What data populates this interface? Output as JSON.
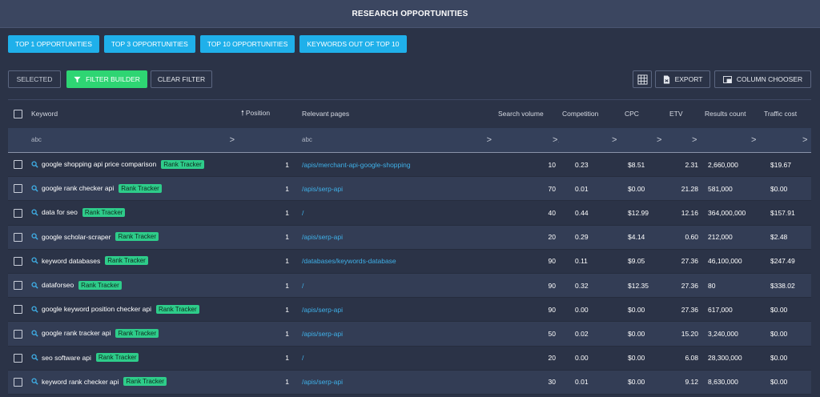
{
  "header": {
    "title": "RESEARCH OPPORTUNITIES"
  },
  "presets": [
    {
      "label": "TOP 1 OPPORTUNITIES"
    },
    {
      "label": "TOP 3 OPPORTUNITIES"
    },
    {
      "label": "TOP 10 OPPORTUNITIES"
    },
    {
      "label": "KEYWORDS OUT OF TOP 10"
    }
  ],
  "toolbar": {
    "selected_label": "SELECTED",
    "filter_builder_label": "FILTER BUILDER",
    "clear_filter_label": "CLEAR FILTER",
    "export_label": "EXPORT",
    "column_chooser_label": "COLUMN CHOOSER"
  },
  "colors": {
    "accent": "#1fb0ea",
    "filter_green": "#2ed573",
    "badge_green": "#2ecc8a",
    "link": "#3fb0e8"
  },
  "table": {
    "columns": {
      "keyword": "Keyword",
      "position": "Position",
      "pages": "Relevant pages",
      "volume": "Search volume",
      "competition": "Competition",
      "cpc": "CPC",
      "etv": "ETV",
      "results": "Results count",
      "traffic_cost": "Traffic cost"
    },
    "sort": {
      "column": "position",
      "direction": "ascending"
    },
    "filter_placeholder": "abc",
    "filter_operator": ">",
    "badge_label": "Rank Tracker",
    "rows": [
      {
        "keyword": "google shopping api price comparison",
        "position": "1",
        "page": "/apis/merchant-api-google-shopping",
        "volume": "10",
        "competition": "0.23",
        "cpc": "$8.51",
        "etv": "2.31",
        "results": "2,660,000",
        "cost": "$19.67"
      },
      {
        "keyword": "google rank checker api",
        "position": "1",
        "page": "/apis/serp-api",
        "volume": "70",
        "competition": "0.01",
        "cpc": "$0.00",
        "etv": "21.28",
        "results": "581,000",
        "cost": "$0.00"
      },
      {
        "keyword": "data for seo",
        "position": "1",
        "page": "/",
        "volume": "40",
        "competition": "0.44",
        "cpc": "$12.99",
        "etv": "12.16",
        "results": "364,000,000",
        "cost": "$157.91"
      },
      {
        "keyword": "google scholar-scraper",
        "position": "1",
        "page": "/apis/serp-api",
        "volume": "20",
        "competition": "0.29",
        "cpc": "$4.14",
        "etv": "0.60",
        "results": "212,000",
        "cost": "$2.48"
      },
      {
        "keyword": "keyword databases",
        "position": "1",
        "page": "/databases/keywords-database",
        "volume": "90",
        "competition": "0.11",
        "cpc": "$9.05",
        "etv": "27.36",
        "results": "46,100,000",
        "cost": "$247.49"
      },
      {
        "keyword": "dataforseo",
        "position": "1",
        "page": "/",
        "volume": "90",
        "competition": "0.32",
        "cpc": "$12.35",
        "etv": "27.36",
        "results": "80",
        "cost": "$338.02"
      },
      {
        "keyword": "google keyword position checker api",
        "position": "1",
        "page": "/apis/serp-api",
        "volume": "90",
        "competition": "0.00",
        "cpc": "$0.00",
        "etv": "27.36",
        "results": "617,000",
        "cost": "$0.00"
      },
      {
        "keyword": "google rank tracker api",
        "position": "1",
        "page": "/apis/serp-api",
        "volume": "50",
        "competition": "0.02",
        "cpc": "$0.00",
        "etv": "15.20",
        "results": "3,240,000",
        "cost": "$0.00"
      },
      {
        "keyword": "seo software api",
        "position": "1",
        "page": "/",
        "volume": "20",
        "competition": "0.00",
        "cpc": "$0.00",
        "etv": "6.08",
        "results": "28,300,000",
        "cost": "$0.00"
      },
      {
        "keyword": "keyword rank checker api",
        "position": "1",
        "page": "/apis/serp-api",
        "volume": "30",
        "competition": "0.01",
        "cpc": "$0.00",
        "etv": "9.12",
        "results": "8,630,000",
        "cost": "$0.00"
      }
    ]
  }
}
